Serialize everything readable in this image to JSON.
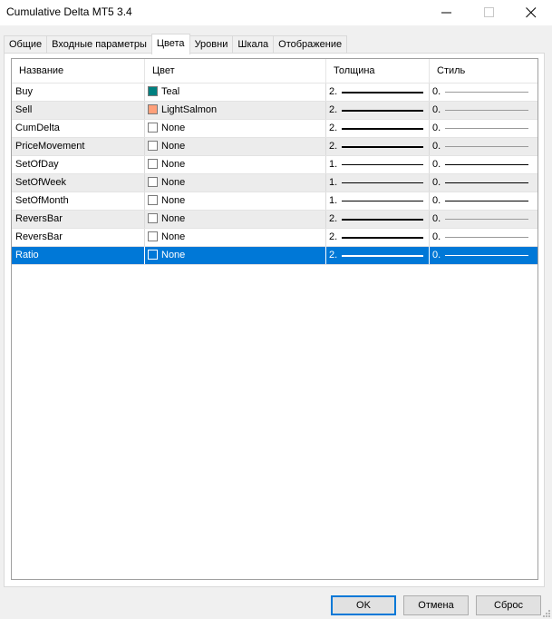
{
  "window": {
    "title": "Cumulative Delta MT5 3.4"
  },
  "tabs": [
    {
      "label": "Общие",
      "active": false
    },
    {
      "label": "Входные параметры",
      "active": false
    },
    {
      "label": "Цвета",
      "active": true
    },
    {
      "label": "Уровни",
      "active": false
    },
    {
      "label": "Шкала",
      "active": false
    },
    {
      "label": "Отображение",
      "active": false
    }
  ],
  "grid": {
    "columns": {
      "name": "Название",
      "color": "Цвет",
      "width": "Толщина",
      "style": "Стиль"
    },
    "rows": [
      {
        "name": "Buy",
        "color": "Teal",
        "swatch": "#008080",
        "width": "2.",
        "style": "0."
      },
      {
        "name": "Sell",
        "color": "LightSalmon",
        "swatch": "#ffa07a",
        "width": "2.",
        "style": "0."
      },
      {
        "name": "CumDelta",
        "color": "None",
        "swatch": "#ffffff",
        "width": "2.",
        "style": "0."
      },
      {
        "name": "PriceMovement",
        "color": "None",
        "swatch": "#ffffff",
        "width": "2.",
        "style": "0."
      },
      {
        "name": "SetOfDay",
        "color": "None",
        "swatch": "#ffffff",
        "width": "1.",
        "style": "0."
      },
      {
        "name": "SetOfWeek",
        "color": "None",
        "swatch": "#ffffff",
        "width": "1.",
        "style": "0."
      },
      {
        "name": "SetOfMonth",
        "color": "None",
        "swatch": "#ffffff",
        "width": "1.",
        "style": "0."
      },
      {
        "name": "ReversBar",
        "color": "None",
        "swatch": "#ffffff",
        "width": "2.",
        "style": "0."
      },
      {
        "name": "ReversBar",
        "color": "None",
        "swatch": "#ffffff",
        "width": "2.",
        "style": "0."
      },
      {
        "name": "Ratio",
        "color": "None",
        "swatch": "#0078d7",
        "width": "2.",
        "style": "0."
      }
    ],
    "selected_index": 9
  },
  "buttons": {
    "ok": "OK",
    "cancel": "Отмена",
    "reset": "Сброс"
  },
  "colors": {
    "selection": "#0078d7",
    "alt_row": "#ececec"
  }
}
